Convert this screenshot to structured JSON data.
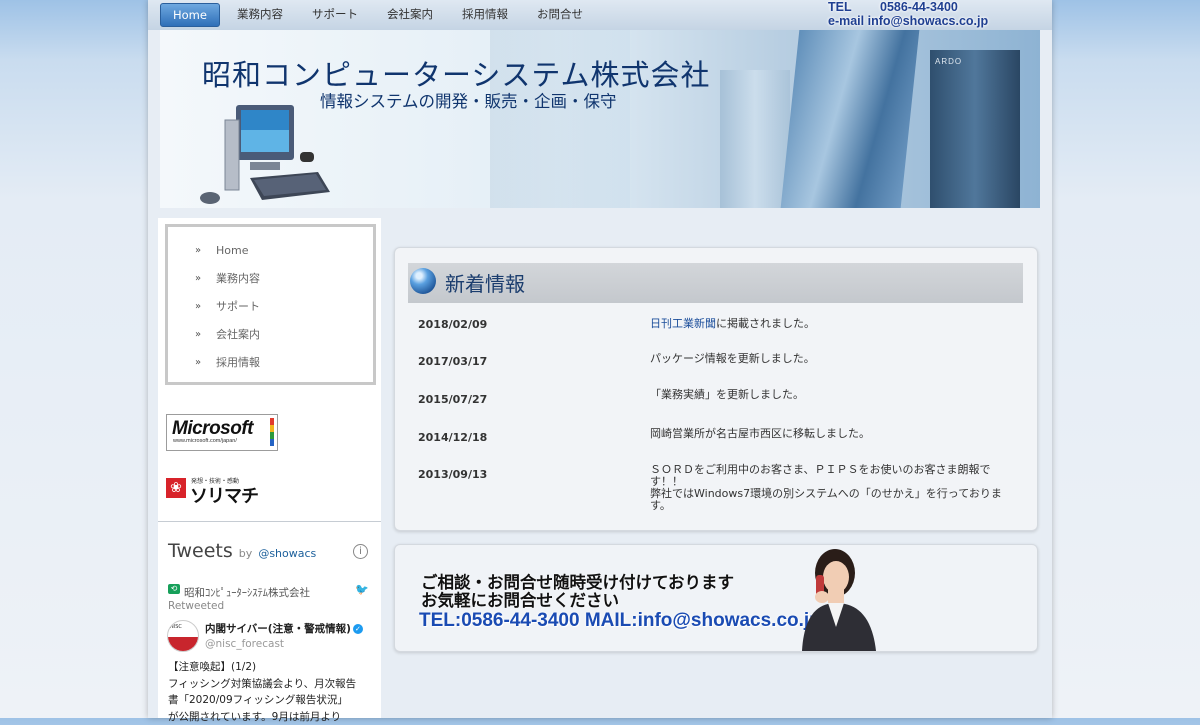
{
  "nav": {
    "items": [
      "Home",
      "業務内容",
      "サポート",
      "会社案内",
      "採用情報",
      "お問合せ"
    ],
    "active": "Home"
  },
  "contact": {
    "tel_label": "TEL",
    "tel": "0586-44-3400",
    "email_line": "e-mail info@showacs.co.jp"
  },
  "banner": {
    "company": "昭和コンピューターシステム株式会社",
    "tagline": "情報システムの開発・販売・企画・保守",
    "sign_text": "ARDO"
  },
  "sidebar": {
    "menu": [
      "Home",
      "業務内容",
      "サポート",
      "会社案内",
      "採用情報"
    ],
    "ms_logo_word": "Microsoft",
    "ms_logo_url": "www.microsoft.com/japan/",
    "sorimachi_small": "発想・技術・感動",
    "sorimachi_word": "ソリマチ"
  },
  "tweets": {
    "title": "Tweets",
    "by": "by",
    "handle": "@showacs",
    "account": "昭和ｺﾝﾋﾟｭｰﾀｰｼｽﾃﾑ株式会社",
    "retweeted": "Retweeted",
    "author_name": "内閣サイバー(注意・警戒情報)",
    "author_handle": "@nisc_forecast",
    "body": [
      "【注意喚起】(1/2)",
      "フィッシング対策協議会より、月次報告",
      "書「2020/09フィッシング報告状況」",
      "が公開されています。9月は前月より"
    ]
  },
  "news": {
    "title": "新着情報",
    "items": [
      {
        "date": "2018/02/09",
        "link": "日刊工業新聞",
        "text": "に掲載されました。"
      },
      {
        "date": "2017/03/17",
        "link": "",
        "text": "パッケージ情報を更新しました。"
      },
      {
        "date": "2015/07/27",
        "link": "",
        "text": "「業務実績」を更新しました。"
      },
      {
        "date": "2014/12/18",
        "link": "",
        "text": "岡崎営業所が名古屋市西区に移転しました。"
      },
      {
        "date": "2013/09/13",
        "link": "",
        "text": "ＳＯＲＤをご利用中のお客さま、ＰＩＰＳをお使いのお客さま朗報です！！\n弊社ではWindows7環境の別システムへの「のせかえ」を行っております。"
      }
    ]
  },
  "contact_banner": {
    "line1": "ご相談・お問合せ随時受け付けております",
    "line2": "お気軽にお問合せください",
    "line3": "TEL:0586-44-3400 MAIL:info@showacs.co.jp"
  },
  "colors": {
    "accent": "#2f6fb8",
    "title_blue": "#10356e",
    "link": "#1c4e9b"
  }
}
